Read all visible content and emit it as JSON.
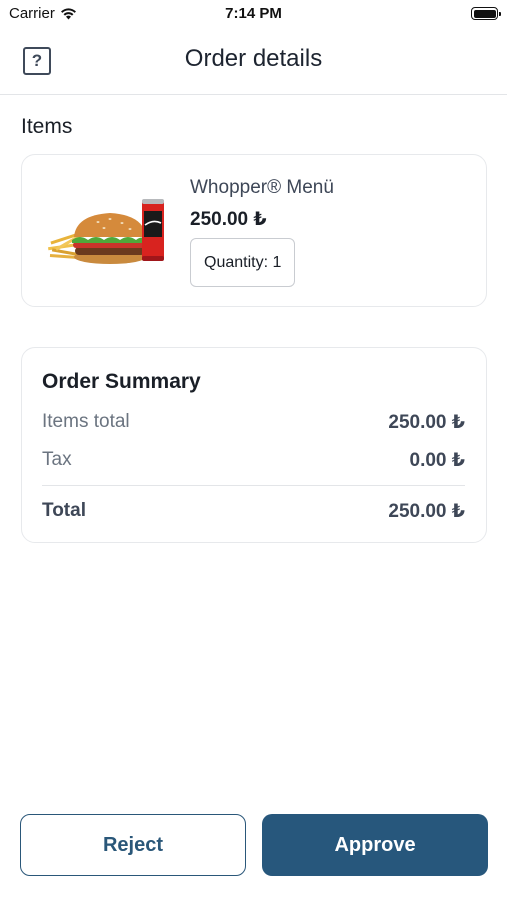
{
  "status_bar": {
    "carrier": "Carrier",
    "time": "7:14 PM"
  },
  "nav": {
    "help_icon": "?",
    "title": "Order details"
  },
  "items_section": {
    "title": "Items",
    "items": [
      {
        "name": "Whopper® Menü",
        "price": "250.00 ₺",
        "quantity_label": "Quantity: 1",
        "image": "burger-menu-image"
      }
    ]
  },
  "summary": {
    "title": "Order Summary",
    "items_total_label": "Items total",
    "items_total_value": "250.00 ₺",
    "tax_label": "Tax",
    "tax_value": "0.00 ₺",
    "total_label": "Total",
    "total_value": "250.00 ₺"
  },
  "actions": {
    "reject_label": "Reject",
    "approve_label": "Approve"
  },
  "colors": {
    "primary": "#27577c",
    "border": "#e7e9ec",
    "muted_text": "#6b7480"
  }
}
